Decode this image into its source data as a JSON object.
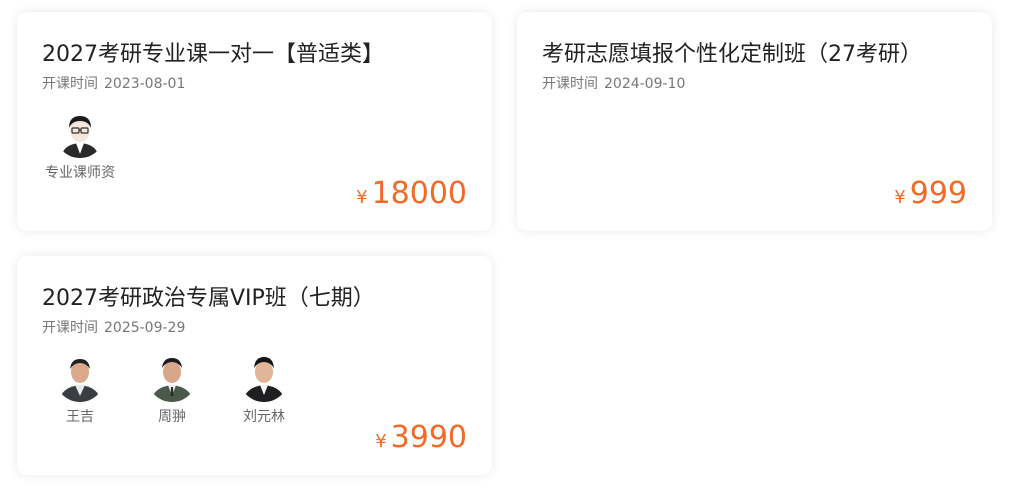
{
  "courses": [
    {
      "title": "2027考研专业课一对一【普适类】",
      "start_label": "开课时间",
      "start_date": "2023-08-01",
      "teachers": [
        {
          "name": "专业课师资",
          "icon": "cartoon-teacher-avatar"
        }
      ],
      "currency": "¥",
      "price": "18000"
    },
    {
      "title": "考研志愿填报个性化定制班（27考研）",
      "start_label": "开课时间",
      "start_date": "2024-09-10",
      "teachers": [],
      "currency": "¥",
      "price": "999"
    },
    {
      "title": "2027考研政治专属VIP班（七期）",
      "start_label": "开课时间",
      "start_date": "2025-09-29",
      "teachers": [
        {
          "name": "王吉",
          "icon": "teacher-photo-avatar"
        },
        {
          "name": "周翀",
          "icon": "teacher-photo-avatar"
        },
        {
          "name": "刘元林",
          "icon": "teacher-photo-avatar"
        }
      ],
      "currency": "¥",
      "price": "3990"
    }
  ],
  "colors": {
    "price": "#f26a25",
    "title": "#222222",
    "meta": "#777777"
  }
}
